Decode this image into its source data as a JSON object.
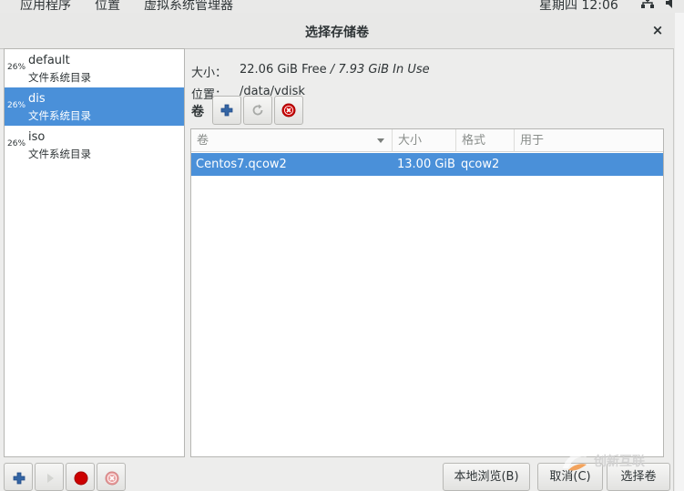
{
  "topbar": {
    "applications": "应用程序",
    "places": "位置",
    "app_name": "虚拟系统管理器",
    "clock": "星期四 12:06"
  },
  "dialog": {
    "title": "选择存储卷",
    "close_glyph": "×"
  },
  "pools": [
    {
      "usage": "26%",
      "name": "default",
      "type": "文件系统目录",
      "selected": false
    },
    {
      "usage": "26%",
      "name": "dis",
      "type": "文件系统目录",
      "selected": true
    },
    {
      "usage": "26%",
      "name": "iso",
      "type": "文件系统目录",
      "selected": false
    }
  ],
  "pool_info": {
    "size_label": "大小：",
    "size_free": "22.06 GiB Free",
    "size_sep": " / ",
    "size_inuse": "7.93 GiB In Use",
    "location_label": "位置：",
    "location": "/data/vdisk"
  },
  "volumes": {
    "label": "卷",
    "columns": [
      "卷",
      "大小",
      "格式",
      "用于"
    ],
    "rows": [
      {
        "name": "Centos7.qcow2",
        "size": "13.00 GiB",
        "format": "qcow2",
        "used_by": ""
      }
    ]
  },
  "buttons": {
    "browse_local": "本地浏览(B)",
    "cancel": "取消(C)",
    "choose_volume": "选择卷"
  },
  "icons": {
    "add_volume": "plus-icon",
    "refresh": "refresh-icon",
    "delete_volume": "delete-icon",
    "add_pool": "plus-icon",
    "start_pool": "play-icon",
    "stop_pool": "stop-icon",
    "delete_pool": "delete-icon"
  },
  "colors": {
    "selection": "#4a90d9",
    "add_blue": "#3465a4",
    "stop_red": "#cc0000"
  },
  "watermark": {
    "text": "创新互联"
  }
}
